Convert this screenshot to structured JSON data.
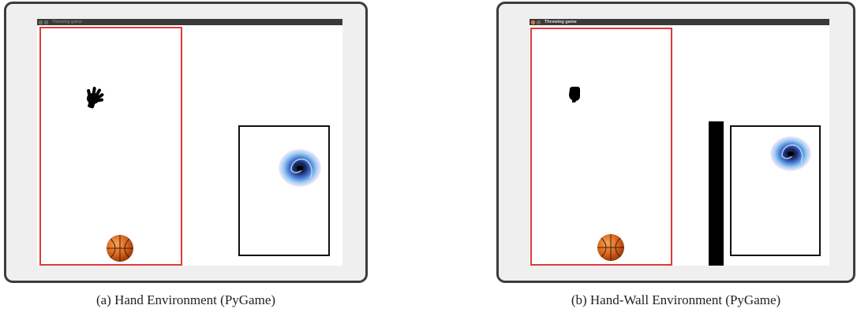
{
  "panels": [
    {
      "window_title": "Throwing game",
      "caption": "(a) Hand Environment (PyGame)",
      "hand_icon": "open-hand-icon",
      "target_icon": "black-hole-vortex-icon",
      "ball_icon": "basketball-icon",
      "has_wall": false
    },
    {
      "window_title": "Throwing game",
      "caption": "(b) Hand-Wall Environment (PyGame)",
      "hand_icon": "closed-fist-icon",
      "target_icon": "black-hole-vortex-icon",
      "ball_icon": "basketball-icon",
      "has_wall": true
    }
  ],
  "colors": {
    "spawn_zone_border": "#e03a3a",
    "target_zone_border": "#111111",
    "titlebar": "#3a3a38",
    "frame": "#efefef"
  }
}
